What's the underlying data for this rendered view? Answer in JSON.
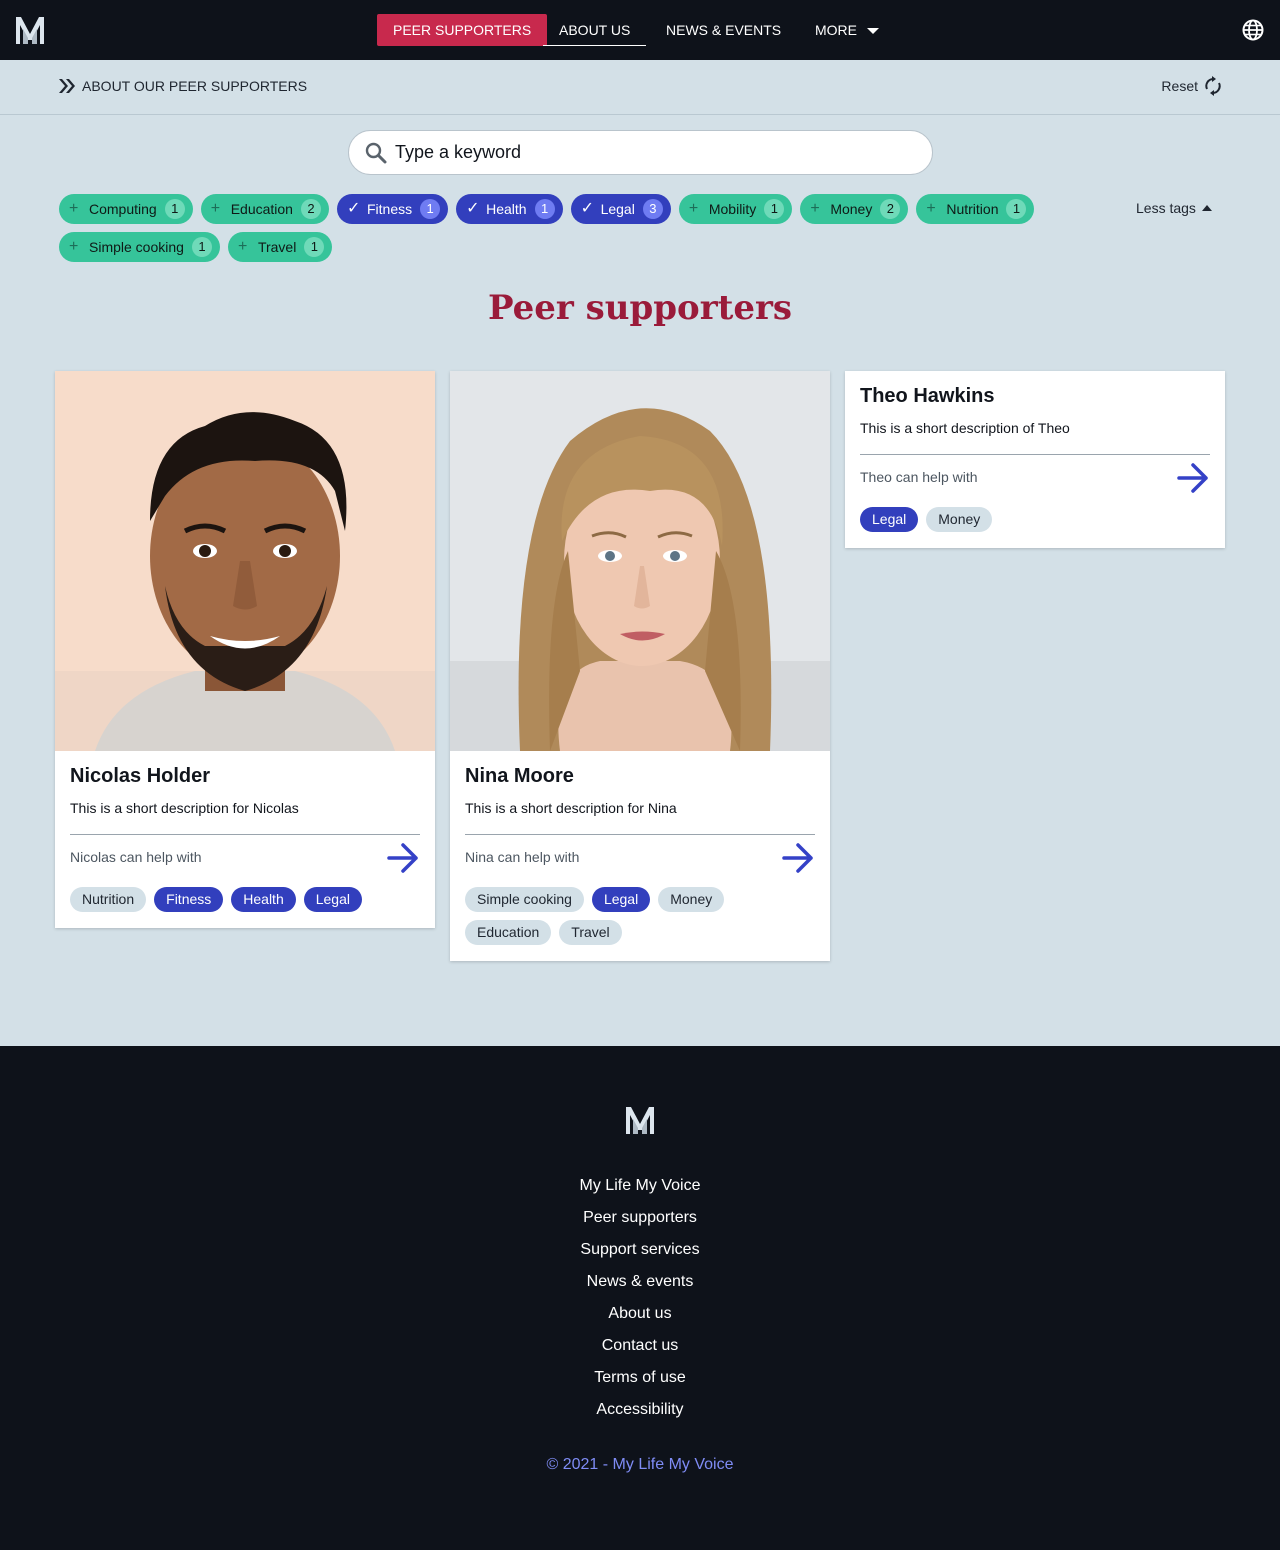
{
  "nav": {
    "items": [
      "PEER SUPPORTERS",
      "ABOUT US",
      "NEWS & EVENTS",
      "MORE"
    ]
  },
  "breadcrumb": "ABOUT OUR PEER SUPPORTERS",
  "reset_label": "Reset",
  "search": {
    "placeholder": "Type a keyword"
  },
  "tags": [
    {
      "label": "Computing",
      "count": "1",
      "selected": false
    },
    {
      "label": "Education",
      "count": "2",
      "selected": false
    },
    {
      "label": "Fitness",
      "count": "1",
      "selected": true
    },
    {
      "label": "Health",
      "count": "1",
      "selected": true
    },
    {
      "label": "Legal",
      "count": "3",
      "selected": true
    },
    {
      "label": "Mobility",
      "count": "1",
      "selected": false
    },
    {
      "label": "Money",
      "count": "2",
      "selected": false
    },
    {
      "label": "Nutrition",
      "count": "1",
      "selected": false
    },
    {
      "label": "Simple cooking",
      "count": "1",
      "selected": false
    },
    {
      "label": "Travel",
      "count": "1",
      "selected": false
    }
  ],
  "less_tags_label": "Less tags",
  "heading": "Peer supporters",
  "cards": [
    {
      "name": "Nicolas Holder",
      "description": "This is a short description for Nicolas",
      "help_label": "Nicolas can help with",
      "chips": [
        {
          "label": "Nutrition",
          "selected": false
        },
        {
          "label": "Fitness",
          "selected": true
        },
        {
          "label": "Health",
          "selected": true
        },
        {
          "label": "Legal",
          "selected": true
        }
      ]
    },
    {
      "name": "Nina Moore",
      "description": "This is a short description for Nina",
      "help_label": "Nina can help with",
      "chips": [
        {
          "label": "Simple cooking",
          "selected": false
        },
        {
          "label": "Legal",
          "selected": true
        },
        {
          "label": "Money",
          "selected": false
        },
        {
          "label": "Education",
          "selected": false
        },
        {
          "label": "Travel",
          "selected": false
        }
      ]
    },
    {
      "name": "Theo Hawkins",
      "description": "This is a short description of Theo",
      "help_label": "Theo can help with",
      "chips": [
        {
          "label": "Legal",
          "selected": true
        },
        {
          "label": "Money",
          "selected": false
        }
      ]
    }
  ],
  "footer": {
    "links": [
      "My Life My Voice",
      "Peer supporters",
      "Support services",
      "News & events",
      "About us",
      "Contact us",
      "Terms of use",
      "Accessibility"
    ],
    "copyright": "© 2021 - My Life My Voice"
  },
  "colors": {
    "nav_bg": "#0e121a",
    "page_bg": "#d3e0e7",
    "accent_red": "#c8294d",
    "heading_red": "#9a1b3a",
    "tag_green": "#36c49a",
    "tag_blue": "#323fbd"
  },
  "icons": [
    "logo-m-icon",
    "globe-icon",
    "double-chevron-icon",
    "refresh-icon",
    "search-icon",
    "plus-icon",
    "check-icon",
    "caret-up-icon",
    "arrow-right-icon"
  ]
}
